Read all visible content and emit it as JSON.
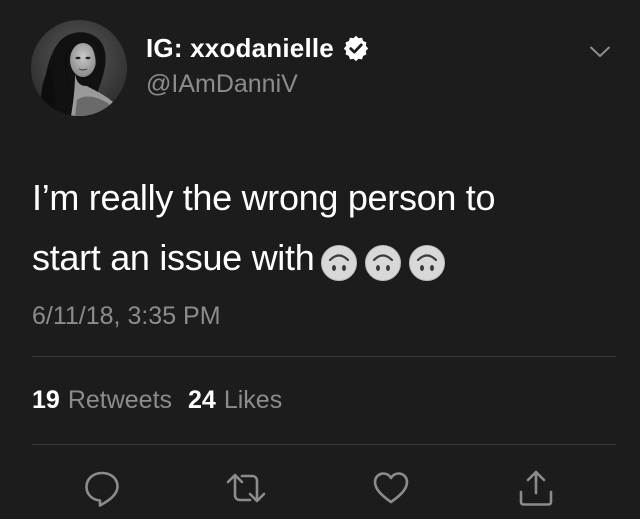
{
  "tweet": {
    "display_name": "IG: xxodanielle",
    "handle": "@IAmDanniV",
    "verified": true,
    "text_line1": "I’m really the wrong person to",
    "text_line2": "start an issue with",
    "emojis": [
      "upside-down-face",
      "upside-down-face",
      "upside-down-face"
    ],
    "timestamp": "6/11/18, 3:35 PM",
    "retweets_count": "19",
    "retweets_label": "Retweets",
    "likes_count": "24",
    "likes_label": "Likes"
  },
  "icons": {
    "reply": "speech-bubble-icon",
    "retweet": "retweet-icon",
    "like": "heart-icon",
    "share": "share-icon",
    "menu": "chevron-down-icon",
    "verified": "verified-badge-icon"
  },
  "colors": {
    "background": "#1c1c1c",
    "primary_text": "#ffffff",
    "secondary_text": "#8c8c8c",
    "divider": "#3a3a3a"
  }
}
